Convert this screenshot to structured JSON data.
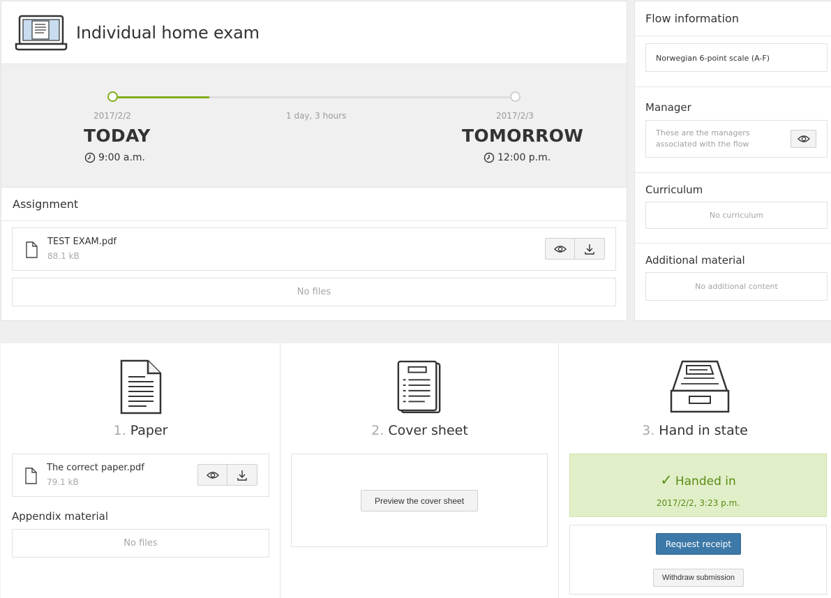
{
  "exam": {
    "title": "Individual home exam",
    "icon": "laptop-icon",
    "start": {
      "date": "2017/2/2",
      "label": "TODAY",
      "time": "9:00 a.m."
    },
    "duration": "1 day, 3 hours",
    "end": {
      "date": "2017/2/3",
      "label": "TOMORROW",
      "time": "12:00 p.m."
    },
    "progress_percent": 24,
    "accent_color": "#7fae1b"
  },
  "assignment": {
    "heading": "Assignment",
    "file": {
      "name": "TEST EXAM.pdf",
      "size": "88.1 kB"
    },
    "empty_text": "No files"
  },
  "flow": {
    "heading": "Flow information",
    "grade_scale": "Norwegian 6-point scale (A-F)",
    "manager": {
      "heading": "Manager",
      "text": "These are the managers associated with the flow"
    },
    "curriculum": {
      "heading": "Curriculum",
      "empty_text": "No curriculum"
    },
    "additional": {
      "heading": "Additional material",
      "empty_text": "No additional content"
    }
  },
  "steps": {
    "paper": {
      "num": "1.",
      "title": "Paper",
      "file": {
        "name": "The correct paper.pdf",
        "size": "79.1 kB"
      },
      "appendix_heading": "Appendix material",
      "appendix_empty": "No files"
    },
    "cover": {
      "num": "2.",
      "title": "Cover sheet",
      "preview_label": "Preview the cover sheet"
    },
    "handin": {
      "num": "3.",
      "title": "Hand in state",
      "status": "Handed in",
      "timestamp": "2017/2/2, 3:23 p.m.",
      "receipt_label": "Request receipt",
      "withdraw_label": "Withdraw submission",
      "status_color": "#5a8a12",
      "primary_color": "#3d79a8"
    }
  }
}
